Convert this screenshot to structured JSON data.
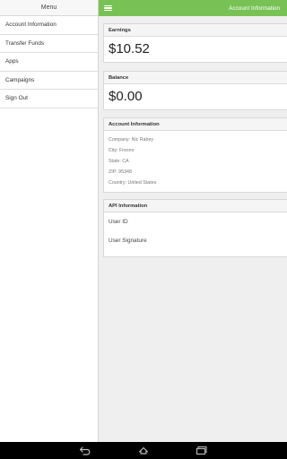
{
  "drawer": {
    "title": "Menu",
    "items": [
      {
        "label": "Account Information"
      },
      {
        "label": "Transfer Funds"
      },
      {
        "label": "Apps"
      },
      {
        "label": "Campaigns"
      },
      {
        "label": "Sign Out"
      }
    ]
  },
  "appbar": {
    "title": "Account Information",
    "menu_icon": "hamburger-icon",
    "color": "#78c255"
  },
  "earnings": {
    "heading": "Earnings",
    "value": "$10.52"
  },
  "balance": {
    "heading": "Balance",
    "value": "$0.00"
  },
  "account_info": {
    "heading": "Account Information",
    "lines": [
      "Company: Nic Rabey",
      "City: Fresno",
      "State: CA",
      "ZIP: 95348",
      "Country: United States"
    ]
  },
  "api_info": {
    "heading": "API Information",
    "user_id_label": "User ID",
    "user_signature_label": "User Signature"
  },
  "navbar": {
    "icons": [
      "back-icon",
      "home-icon",
      "recent-apps-icon"
    ]
  }
}
